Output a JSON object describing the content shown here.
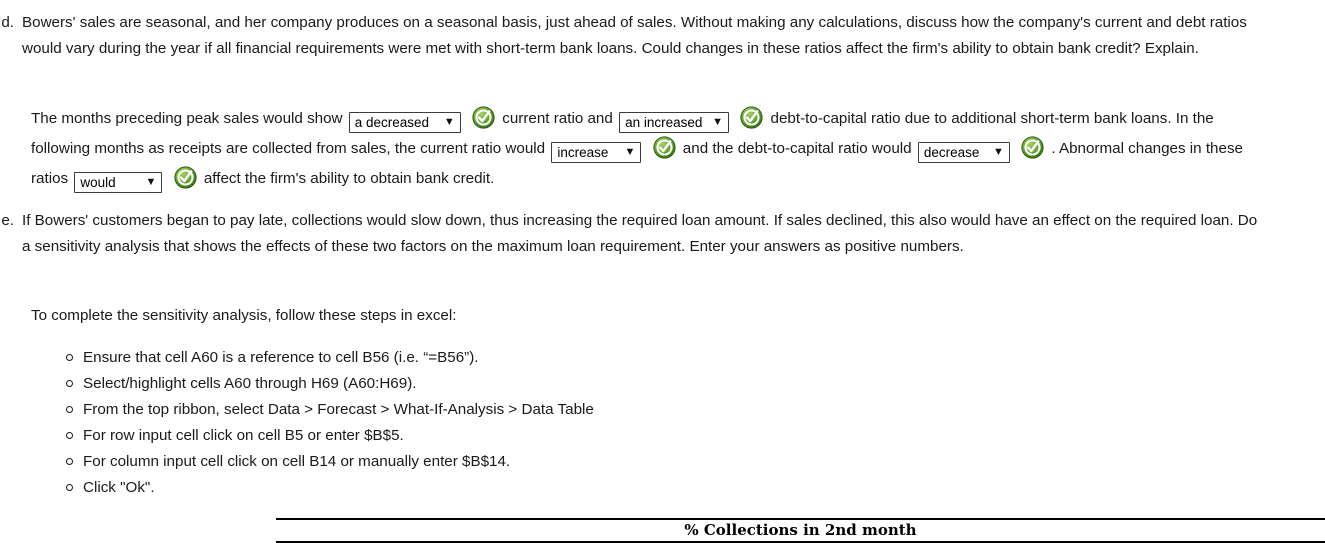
{
  "question_d": {
    "letter": "d.",
    "text": "Bowers' sales are seasonal, and her company produces on a seasonal basis, just ahead of sales. Without making any calculations, discuss how the company's current and debt ratios would vary during the year if all financial requirements were met with short-term bank loans. Could changes in these ratios affect the firm's ability to obtain bank credit? Explain."
  },
  "answer_d": {
    "seg1": "The months preceding peak sales would show",
    "seg2": "current ratio and",
    "seg3": "debt-to-capital ratio due to additional short-term bank loans. In the following months as receipts are collected from sales, the current ratio would",
    "seg4": "and the debt-to-capital ratio would",
    "seg5": ".",
    "seg6": "Abnormal changes in these ratios",
    "seg7": "affect the firm's ability to obtain bank credit.",
    "dropdowns": [
      {
        "name": "current-ratio-direction",
        "value": "a decreased"
      },
      {
        "name": "debt-to-capital-direction",
        "value": "an increased"
      },
      {
        "name": "current-ratio-later-direction",
        "value": "increase"
      },
      {
        "name": "debt-to-capital-later-direction",
        "value": "decrease"
      },
      {
        "name": "abnormal-changes-effect",
        "value": "would"
      }
    ],
    "chevron_glyph": "⌄",
    "validation_icon": "green-check-badge",
    "validation_color": "#4e9a2e"
  },
  "question_e": {
    "letter": "e.",
    "text": "If Bowers' customers began to pay late, collections would slow down, thus increasing the required loan amount. If sales declined, this also would have an effect on the required loan. Do a sensitivity analysis that shows the effects of these two factors on the maximum loan requirement. Enter your answers as positive numbers."
  },
  "steps_intro": "To complete the sensitivity analysis, follow these steps in excel:",
  "steps": [
    "Ensure that cell A60 is a reference to cell B56 (i.e. “=B56”).",
    "Select/highlight cells A60 through H69 (A60:H69).",
    "From the top ribbon, select Data > Forecast > What-If-Analysis > Data Table",
    "For row input cell click on cell B5 or enter $B$5.",
    "For column input cell click on cell B14 or manually enter $B$14.",
    "Click \"Ok\"."
  ],
  "table_header": {
    "caption": "% Collections in 2nd month"
  }
}
